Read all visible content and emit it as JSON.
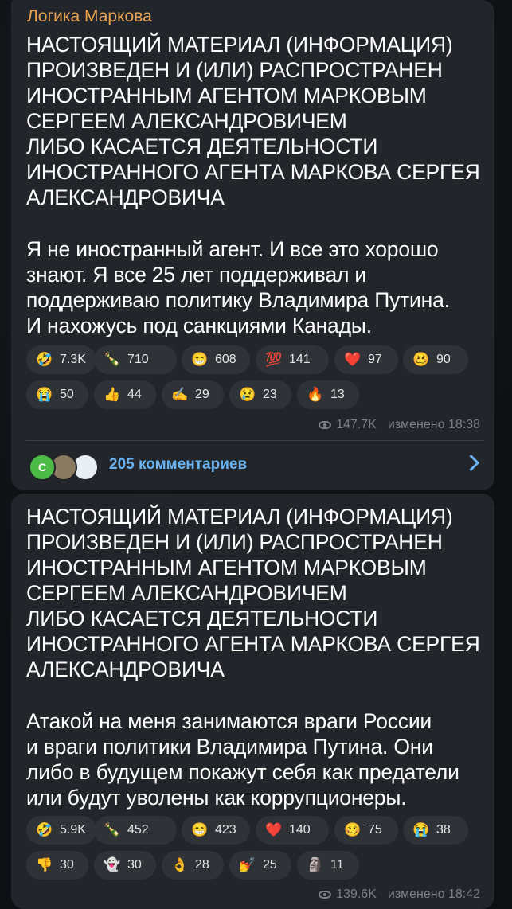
{
  "post1": {
    "channel": "Логика Маркова",
    "notice": "НАСТОЯЩИЙ МАТЕРИАЛ (ИНФОРМАЦИЯ)\nПРОИЗВЕДЕН И (ИЛИ) РАСПРОСТРАНЕН\nИНОСТРАННЫМ АГЕНТОМ МАРКОВЫМ\nСЕРГЕЕМ АЛЕКСАНДРОВИЧЕМ\nЛИБО КАСАЕТСЯ ДЕЯТЕЛЬНОСТИ\nИНОСТРАННОГО АГЕНТА МАРКОВА СЕРГЕЯ\nАЛЕКСАНДРОВИЧА",
    "body": "Я не иностранный агент. И все это хорошо\nзнают. Я все 25 лет поддерживал и\nподдерживаю политику Владимира Путина.\nИ нахожусь под санкциями Канады.",
    "reactions": [
      {
        "emoji": "🤣",
        "count": "7.3K",
        "color": "#f5c542"
      },
      {
        "emoji": "🍾",
        "count": "710",
        "color": "#3d6b3a"
      },
      {
        "emoji": "😁",
        "count": "608",
        "color": "#f5c542"
      },
      {
        "emoji": "💯",
        "count": "141",
        "color": "#00000000"
      },
      {
        "emoji": "❤️",
        "count": "97",
        "color": "#00000000"
      },
      {
        "emoji": "🥴",
        "count": "90",
        "color": "#f5c542"
      },
      {
        "emoji": "😭",
        "count": "50",
        "color": "#f5c542"
      },
      {
        "emoji": "👍",
        "count": "44",
        "color": "#f5c542"
      },
      {
        "emoji": "✍️",
        "count": "29",
        "color": "#00000000"
      },
      {
        "emoji": "😢",
        "count": "23",
        "color": "#f5c542"
      },
      {
        "emoji": "🔥",
        "count": "13",
        "color": "#00000000"
      }
    ],
    "views": "147.7K",
    "edited": "изменено 18:38",
    "comments_label": "205 комментариев",
    "avatar_letter": "С"
  },
  "post2": {
    "notice": "НАСТОЯЩИЙ МАТЕРИАЛ (ИНФОРМАЦИЯ)\nПРОИЗВЕДЕН И (ИЛИ) РАСПРОСТРАНЕН\nИНОСТРАННЫМ АГЕНТОМ МАРКОВЫМ\nСЕРГЕЕМ АЛЕКСАНДРОВИЧЕМ\nЛИБО КАСАЕТСЯ ДЕЯТЕЛЬНОСТИ\nИНОСТРАННОГО АГЕНТА МАРКОВА СЕРГЕЯ\nАЛЕКСАНДРОВИЧА",
    "body": "Атакой на меня занимаются враги России\nи враги политики Владимира Путина. Они\nлибо в будущем покажут себя как предатели\nили будут уволены как коррупционеры.",
    "reactions": [
      {
        "emoji": "🤣",
        "count": "5.9K",
        "color": "#f5c542"
      },
      {
        "emoji": "🍾",
        "count": "452",
        "color": "#3d6b3a"
      },
      {
        "emoji": "😁",
        "count": "423",
        "color": "#f5c542"
      },
      {
        "emoji": "❤️",
        "count": "140",
        "color": "#00000000"
      },
      {
        "emoji": "🥴",
        "count": "75",
        "color": "#f5c542"
      },
      {
        "emoji": "😭",
        "count": "38",
        "color": "#f5c542"
      },
      {
        "emoji": "👎",
        "count": "30",
        "color": "#f5c542"
      },
      {
        "emoji": "👻",
        "count": "30",
        "color": "#00000000"
      },
      {
        "emoji": "👌",
        "count": "28",
        "color": "#f5c542"
      },
      {
        "emoji": "💅",
        "count": "25",
        "color": "#00000000"
      },
      {
        "emoji": "🗿",
        "count": "11",
        "color": "#00000000"
      }
    ],
    "views": "139.6K",
    "edited": "изменено 18:42"
  }
}
